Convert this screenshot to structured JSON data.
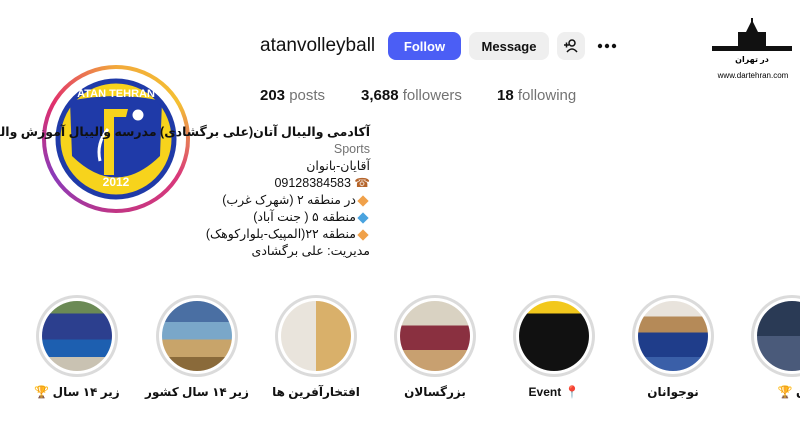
{
  "profile": {
    "username": "atanvolleyball",
    "follow_label": "Follow",
    "message_label": "Message",
    "logo_top_text": "ATAN TEHRAN",
    "logo_year": "2012",
    "logo_letters": "آتان"
  },
  "stats": {
    "posts_count": "203",
    "posts_label": "posts",
    "followers_count": "3,688",
    "followers_label": "followers",
    "following_count": "18",
    "following_label": "following"
  },
  "bio": {
    "title": "آکادمی والیبال آتان(علی برگشادی) مدرسه والیبال آموزش والیبال",
    "category": "Sports",
    "line_gender": "آقایان-بانوان",
    "phone": "09128384583",
    "area1": "در منطقه ۲ (شهرک غرب)",
    "area2": "منطقه ۵ ( جنت آباد)",
    "area3": "منطقه ۲۲(المپیک-بلوارکوهک)",
    "manager": "مدیریت: علی برگشادی"
  },
  "highlights": [
    {
      "label": "🏆 زیر ۱۴ سال"
    },
    {
      "label": "زیر ۱۴ سال کشور"
    },
    {
      "label": "افتخارآفرین ها"
    },
    {
      "label": "بزرگسالان"
    },
    {
      "label": "Event 📍"
    },
    {
      "label": "نوجوانان"
    },
    {
      "label": "🏆 ن"
    }
  ],
  "watermark": {
    "title": "در تهران",
    "url": "www.dartehran.com"
  },
  "colors": {
    "follow_button": "#4b5ef5",
    "logo_blue": "#1f3aa8",
    "logo_yellow": "#f7d31c"
  },
  "icons": {
    "add_user": "add-user-icon",
    "more": "more-icon",
    "phone": "phone-icon"
  }
}
